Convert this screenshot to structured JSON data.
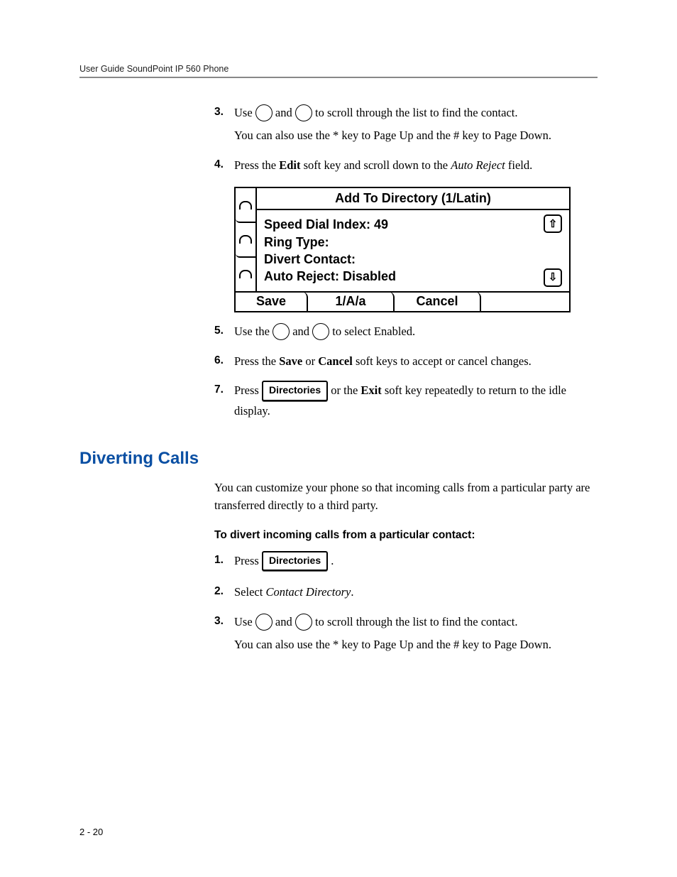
{
  "header": {
    "running": "User Guide SoundPoint IP 560 Phone"
  },
  "steps_a": {
    "s3": {
      "num": "3.",
      "p1a": "Use ",
      "p1b": " and ",
      "p1c": " to scroll through the list to find the contact.",
      "p2": "You can also use the * key to Page Up and the # key to Page Down."
    },
    "s4": {
      "num": "4.",
      "p_a": "Press the ",
      "p_b": "Edit",
      "p_c": " soft key and scroll down to the ",
      "p_d": "Auto Reject",
      "p_e": " field."
    },
    "s5": {
      "num": "5.",
      "p_a": "Use the ",
      "p_b": " and ",
      "p_c": " to select Enabled."
    },
    "s6": {
      "num": "6.",
      "p_a": "Press the ",
      "p_b": "Save",
      "p_c": " or ",
      "p_d": "Cancel",
      "p_e": " soft keys to accept or cancel changes."
    },
    "s7": {
      "num": "7.",
      "p_a": "Press ",
      "btn": "Directories",
      "p_b": " or the ",
      "p_c": "Exit",
      "p_d": " soft key repeatedly to return to the idle display."
    }
  },
  "screen": {
    "title": "Add To Directory (1/Latin)",
    "line1": "Speed Dial Index: 49",
    "line2": "Ring Type:",
    "line3": "Divert Contact:",
    "line4": "Auto Reject: Disabled",
    "sk1": "Save",
    "sk2": "1/A/a",
    "sk3": "Cancel"
  },
  "section": {
    "heading": "Diverting Calls",
    "para": "You can customize your phone so that incoming calls from a particular party are transferred directly to a third party.",
    "sub": "To divert incoming calls from a particular contact:"
  },
  "steps_b": {
    "s1": {
      "num": "1.",
      "p_a": "Press ",
      "btn": "Directories",
      "p_b": " ."
    },
    "s2": {
      "num": "2.",
      "p_a": "Select ",
      "p_b": "Contact Directory",
      "p_c": "."
    },
    "s3": {
      "num": "3.",
      "p1a": "Use ",
      "p1b": " and ",
      "p1c": " to scroll through the list to find the contact.",
      "p2": "You can also use the * key to Page Up and the # key to Page Down."
    }
  },
  "footer": {
    "page": "2 - 20"
  }
}
